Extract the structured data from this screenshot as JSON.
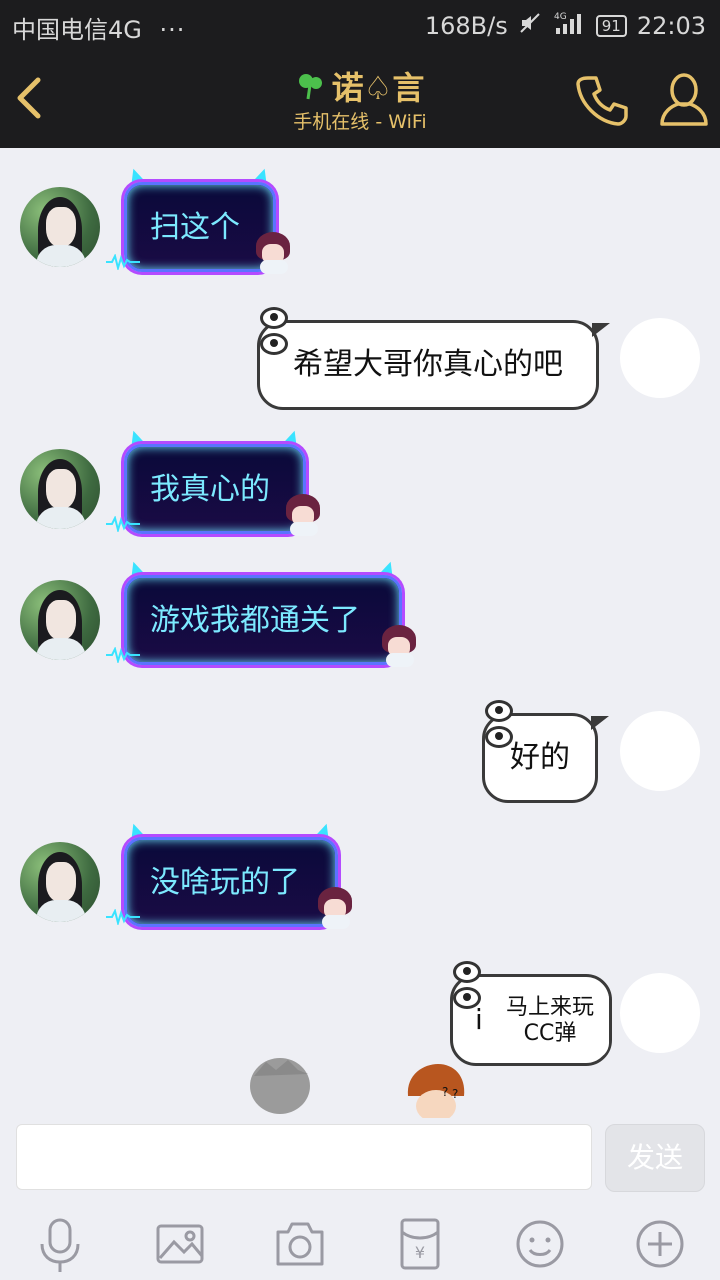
{
  "status_bar": {
    "carrier": "中国电信4G",
    "dots": "···",
    "speed": "168B/s",
    "network": "4G",
    "battery": "91",
    "time": "22:03"
  },
  "header": {
    "title": "诺♤言",
    "subtitle": "手机在线 - WiFi"
  },
  "messages": [
    {
      "side": "left",
      "text": "扫这个"
    },
    {
      "side": "right",
      "text": "希望大哥你真心的吧"
    },
    {
      "side": "left",
      "text": "我真心的"
    },
    {
      "side": "left",
      "text": "游戏我都通关了"
    },
    {
      "side": "right",
      "text": "好的"
    },
    {
      "side": "left",
      "text": "没啥玩的了"
    },
    {
      "side": "right",
      "text": "马上来玩\nCC弹",
      "line1": "马上来玩",
      "line2": "CC弹",
      "prefix": "i"
    }
  ],
  "input": {
    "value": "",
    "send_label": "发送"
  },
  "toolbar": {
    "icons": [
      "microphone-icon",
      "image-icon",
      "camera-icon",
      "red-packet-icon",
      "emoji-icon",
      "plus-icon"
    ],
    "red_packet_glyph": "¥"
  },
  "colors": {
    "header_bg": "#1c1c1e",
    "accent_gold": "#e6c16a",
    "chat_bg": "#eeeff4",
    "neon_text": "#7ce9ff"
  }
}
